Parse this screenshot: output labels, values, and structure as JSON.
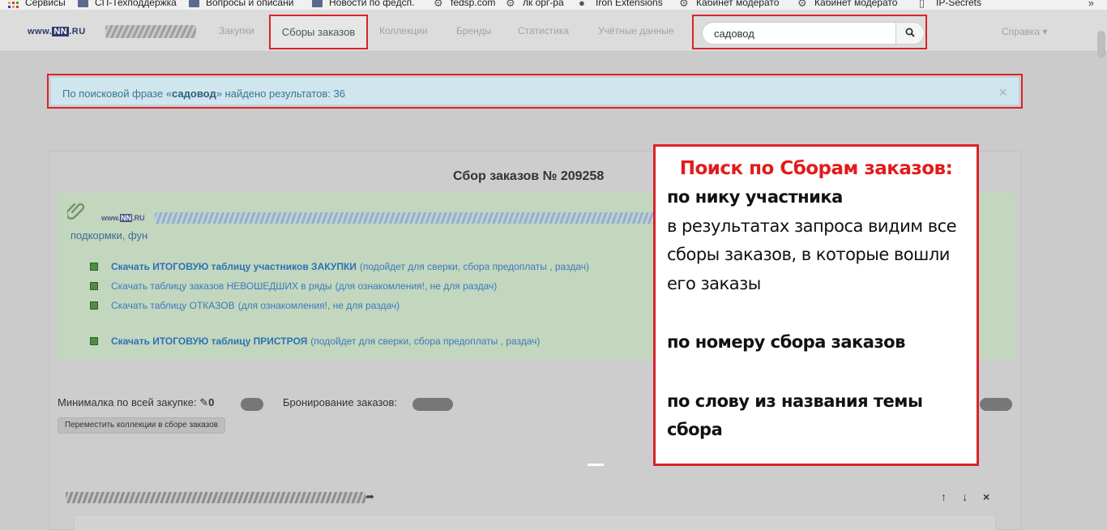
{
  "bookmarks": [
    {
      "label": "Сервисы"
    },
    {
      "label": "СП-Техподдержка"
    },
    {
      "label": "Вопросы и описани"
    },
    {
      "label": "Новости по федсп."
    },
    {
      "label": "fedsp.com"
    },
    {
      "label": "лк орг-ра"
    },
    {
      "label": "Iron Extensions"
    },
    {
      "label": "Кабинет модерато"
    },
    {
      "label": "Кабинет модерато"
    },
    {
      "label": "IP-Secrets"
    }
  ],
  "bookmarks_more": "»",
  "navbar": {
    "logo_prefix": "www.",
    "logo_brand": "NN",
    "logo_suffix": ".RU",
    "links": [
      "Закупки",
      "Сборы заказов",
      "Коллекции",
      "Бренды",
      "Статистика",
      "Учётные данные"
    ],
    "active_link": "Сборы заказов",
    "search_value": "садовод",
    "help_label": "Справка ▾"
  },
  "alert": {
    "prefix": "По поисковой фразе «",
    "query": "садовод",
    "suffix": "» найдено результатов: 36",
    "close": "×"
  },
  "panel": {
    "title": "Сбор заказов № 209258",
    "logo_prefix": "www.",
    "logo_brand": "NN",
    "logo_suffix": ".RU",
    "feed_text": "подкормки, фун",
    "downloads": [
      {
        "main": "Скачать ИТОГОВУЮ таблицу участников ЗАКУПКИ",
        "sub": "(подойдет для сверки, сбора предоплаты , раздач)",
        "bold": true
      },
      {
        "main": "Скачать таблицу заказов НЕВОШЕДШИХ в ряды",
        "sub": "(для ознакомления!, не для раздач)",
        "bold": false
      },
      {
        "main": "Скачать таблицу ОТКАЗОВ",
        "sub": "(для ознакомления!, не для раздач)",
        "bold": false
      },
      {
        "main": "Скачать ИТОГОВУЮ таблицу ПРИСТРОЯ",
        "sub": "(подойдет для сверки, сбора предоплаты , раздач)",
        "bold": true
      }
    ],
    "min_label": "Минималка по всей закупке:",
    "min_value": "0",
    "booking_label": "Бронирование заказов:",
    "move_button": "Переместить коллекции в сборе заказов",
    "controls": [
      "↑",
      "↓",
      "×"
    ]
  },
  "callout": {
    "title": "Поиск по Сборам заказов:",
    "lines": [
      {
        "text": "по нику участника",
        "bold": true
      },
      {
        "text": "в результатах запроса видим все",
        "bold": false
      },
      {
        "text": "сборы заказов, в которые вошли",
        "bold": false
      },
      {
        "text": "его заказы",
        "bold": false
      },
      {
        "text": "по номеру сбора заказов",
        "bold": true
      },
      {
        "text": "по слову из названия темы",
        "bold": true
      },
      {
        "text": "сбора",
        "bold": true
      }
    ]
  },
  "colors": {
    "annotation_red": "#d9232a",
    "link_blue": "#3b7bbd",
    "alert_bg": "#cfe6ef",
    "green_box": "#c3d6be"
  }
}
